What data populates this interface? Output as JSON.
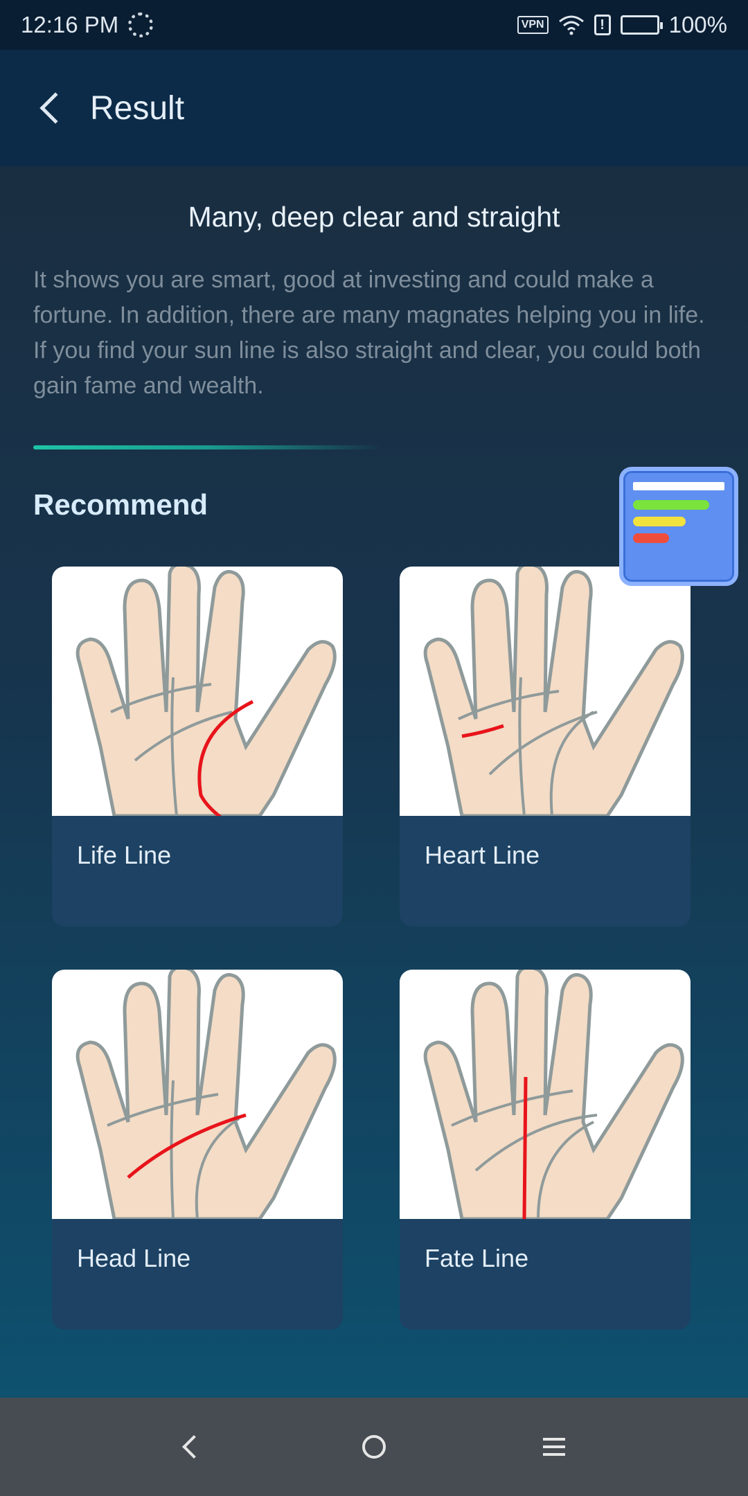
{
  "status_bar": {
    "time": "12:16 PM",
    "vpn": "VPN",
    "alert": "!",
    "battery": "100%"
  },
  "app_bar": {
    "title": "Result"
  },
  "result": {
    "heading": "Many, deep clear and straight",
    "description": "It shows you are smart, good at investing and could make a fortune. In addition, there are many magnates helping you in life. If you find your sun line is also straight and clear, you could both gain fame and wealth."
  },
  "recommend": {
    "title": "Recommend",
    "cards": [
      {
        "label": "Life Line"
      },
      {
        "label": "Heart Line"
      },
      {
        "label": "Head Line"
      },
      {
        "label": "Fate Line"
      }
    ]
  },
  "colors": {
    "accent_line": "#1fc5a6",
    "highlight_red": "#e8141b",
    "card_bg": "#1d4263"
  },
  "icons": {
    "back": "chevron-left-icon",
    "floating_widget": "list-widget-icon",
    "nav_back": "nav-back-icon",
    "nav_home": "nav-home-icon",
    "nav_menu": "nav-menu-icon"
  }
}
